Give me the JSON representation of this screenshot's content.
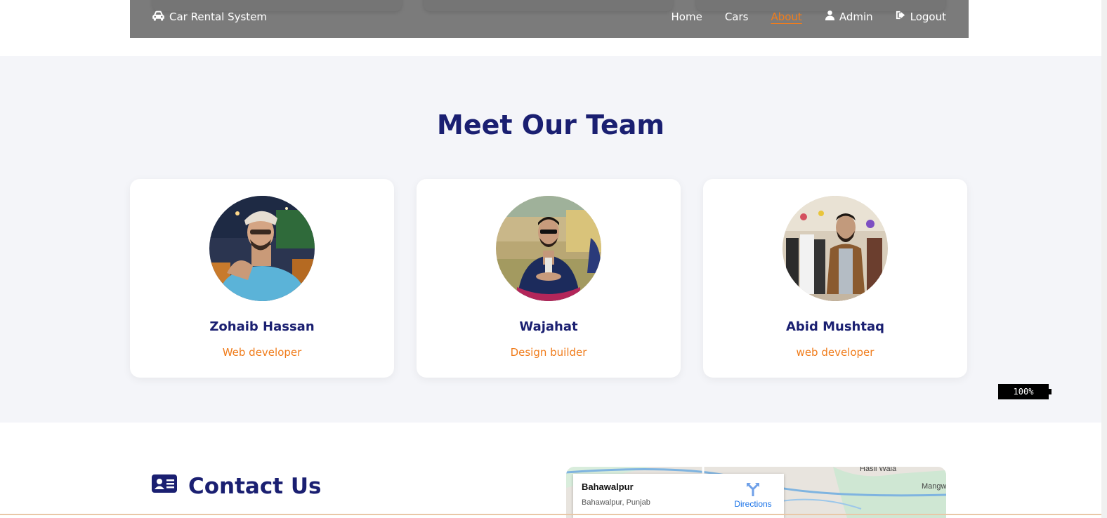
{
  "nav": {
    "brand": "Car Rental System",
    "brand_icon": "car-icon",
    "links": [
      {
        "label": "Home",
        "icon": null,
        "active": false
      },
      {
        "label": "Cars",
        "icon": null,
        "active": false
      },
      {
        "label": "About",
        "icon": null,
        "active": true
      },
      {
        "label": "Admin",
        "icon": "user-icon",
        "active": false
      },
      {
        "label": "Logout",
        "icon": "sign-out-icon",
        "active": false
      }
    ]
  },
  "team": {
    "title": "Meet Our Team",
    "members": [
      {
        "name": "Zohaib Hassan",
        "role": "Web developer"
      },
      {
        "name": "Wajahat",
        "role": "Design builder"
      },
      {
        "name": "Abid Mushtaq",
        "role": "web developer"
      }
    ]
  },
  "battery": {
    "label": "100%"
  },
  "contact": {
    "title": "Contact Us",
    "icon": "address-card-icon"
  },
  "map": {
    "place": "Bahawalpur",
    "subtitle": "Bahawalpur, Punjab",
    "directions": "Directions",
    "label_1": "Hasil Wala",
    "label_2": "Mangw"
  },
  "colors": {
    "accent": "#f07c1b",
    "heading": "#1a1f71",
    "navbar": "#7b7b7b",
    "section_bg": "#f4f5f9"
  }
}
